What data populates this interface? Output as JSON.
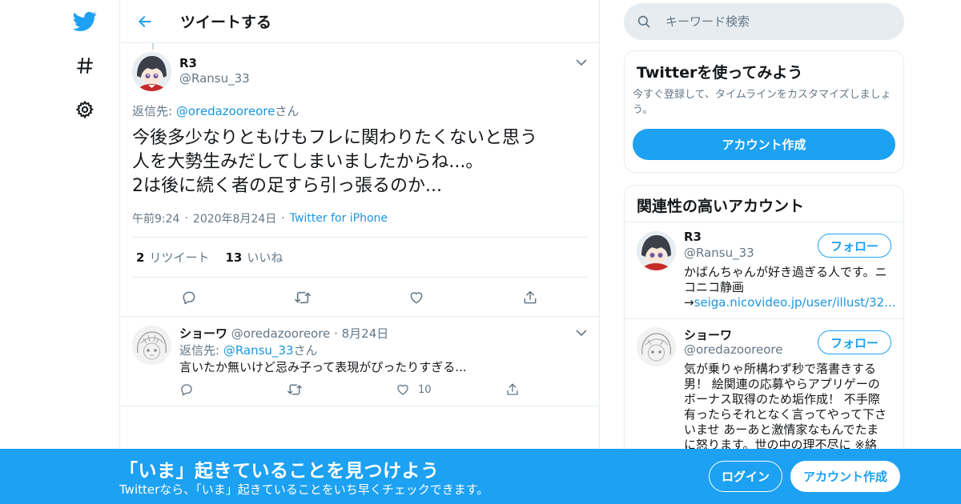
{
  "colors": {
    "accent": "#1da1f2",
    "secondary_text": "#657786",
    "border": "#e6ecf0"
  },
  "nav": {
    "items": [
      {
        "icon": "twitter-bird-icon"
      },
      {
        "icon": "hashtag-icon"
      },
      {
        "icon": "settings-gear-icon"
      }
    ]
  },
  "header": {
    "title": "ツイートする"
  },
  "focus_tweet": {
    "name": "R3",
    "handle": "@Ransu_33",
    "reply_label": "返信先: ",
    "reply_handle": "@oredazooreore",
    "reply_suffix": "さん",
    "text": "今後多少なりともけもフレに関わりたくないと思う\n人を大勢生みだしてしまいましたからね...。\n2は後に続く者の足すら引っ張るのか...",
    "time": "午前9:24",
    "date": "2020年8月24日",
    "source": "Twitter for iPhone",
    "retweets": "2",
    "retweets_label": "リツイート",
    "likes": "13",
    "likes_label": "いいね"
  },
  "reply_tweet": {
    "name": "ショーワ",
    "handle": "@oredazooreore",
    "date": "8月24日",
    "reply_label": "返信先: ",
    "reply_handle": "@Ransu_33",
    "reply_suffix": "さん",
    "text": "言いたか無いけど忌み子って表現がぴったりすぎる...",
    "likes": "10"
  },
  "search": {
    "placeholder": "キーワード検索"
  },
  "try_card": {
    "title": "Twitterを使ってみよう",
    "desc": "今すぐ登録して、タイムラインをカスタマイズしましょう。",
    "button": "アカウント作成"
  },
  "related": {
    "title": "関連性の高いアカウント",
    "accounts": [
      {
        "name": "R3",
        "handle": "@Ransu_33",
        "bio": "かばんちゃんが好き過ぎる人です。ニ\nコニコ静画\n→",
        "bio_link": "seiga.nicovideo.jp/user/illust/32...",
        "button": "フォロー"
      },
      {
        "name": "ショーワ",
        "handle": "@oredazooreore",
        "bio": "気が乗りゃ所構わず秒で落書きする\n男！ 絵関連の応募やらアプリゲーの\nボーナス取得のため垢作成！ 不手際\n有ったらそれとなく言ってやって下さ\nいませ あーあと激情家なもんでたま\nに怒ります。世の中の理不尽に ※絡",
        "button": "フォロー"
      }
    ]
  },
  "banner": {
    "title": "「いま」起きていることを見つけよう",
    "subtitle": "Twitterなら、「いま」起きていることをいち早くチェックできます。",
    "login": "ログイン",
    "signup": "アカウント作成"
  }
}
